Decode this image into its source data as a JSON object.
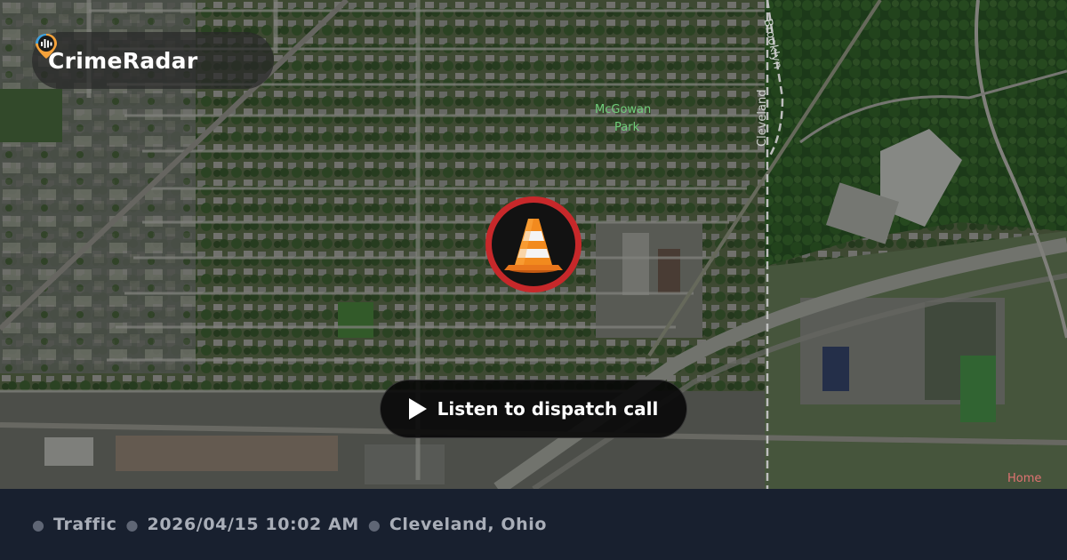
{
  "brand": {
    "name": "CrimeRadar",
    "logo_icon": "radar-pin-icon"
  },
  "incident": {
    "icon": "traffic-cone-icon",
    "accent": "#c7282a"
  },
  "action": {
    "label": "Listen to dispatch call",
    "icon": "play-icon"
  },
  "map_labels": {
    "park": "McGowan",
    "park2": "Park",
    "road1": "Brooklyn",
    "road2": "Cleveland",
    "poi": "Home"
  },
  "footer": {
    "category": "Traffic",
    "datetime": "2026/04/15 10:02 AM",
    "location": "Cleveland, Ohio"
  }
}
